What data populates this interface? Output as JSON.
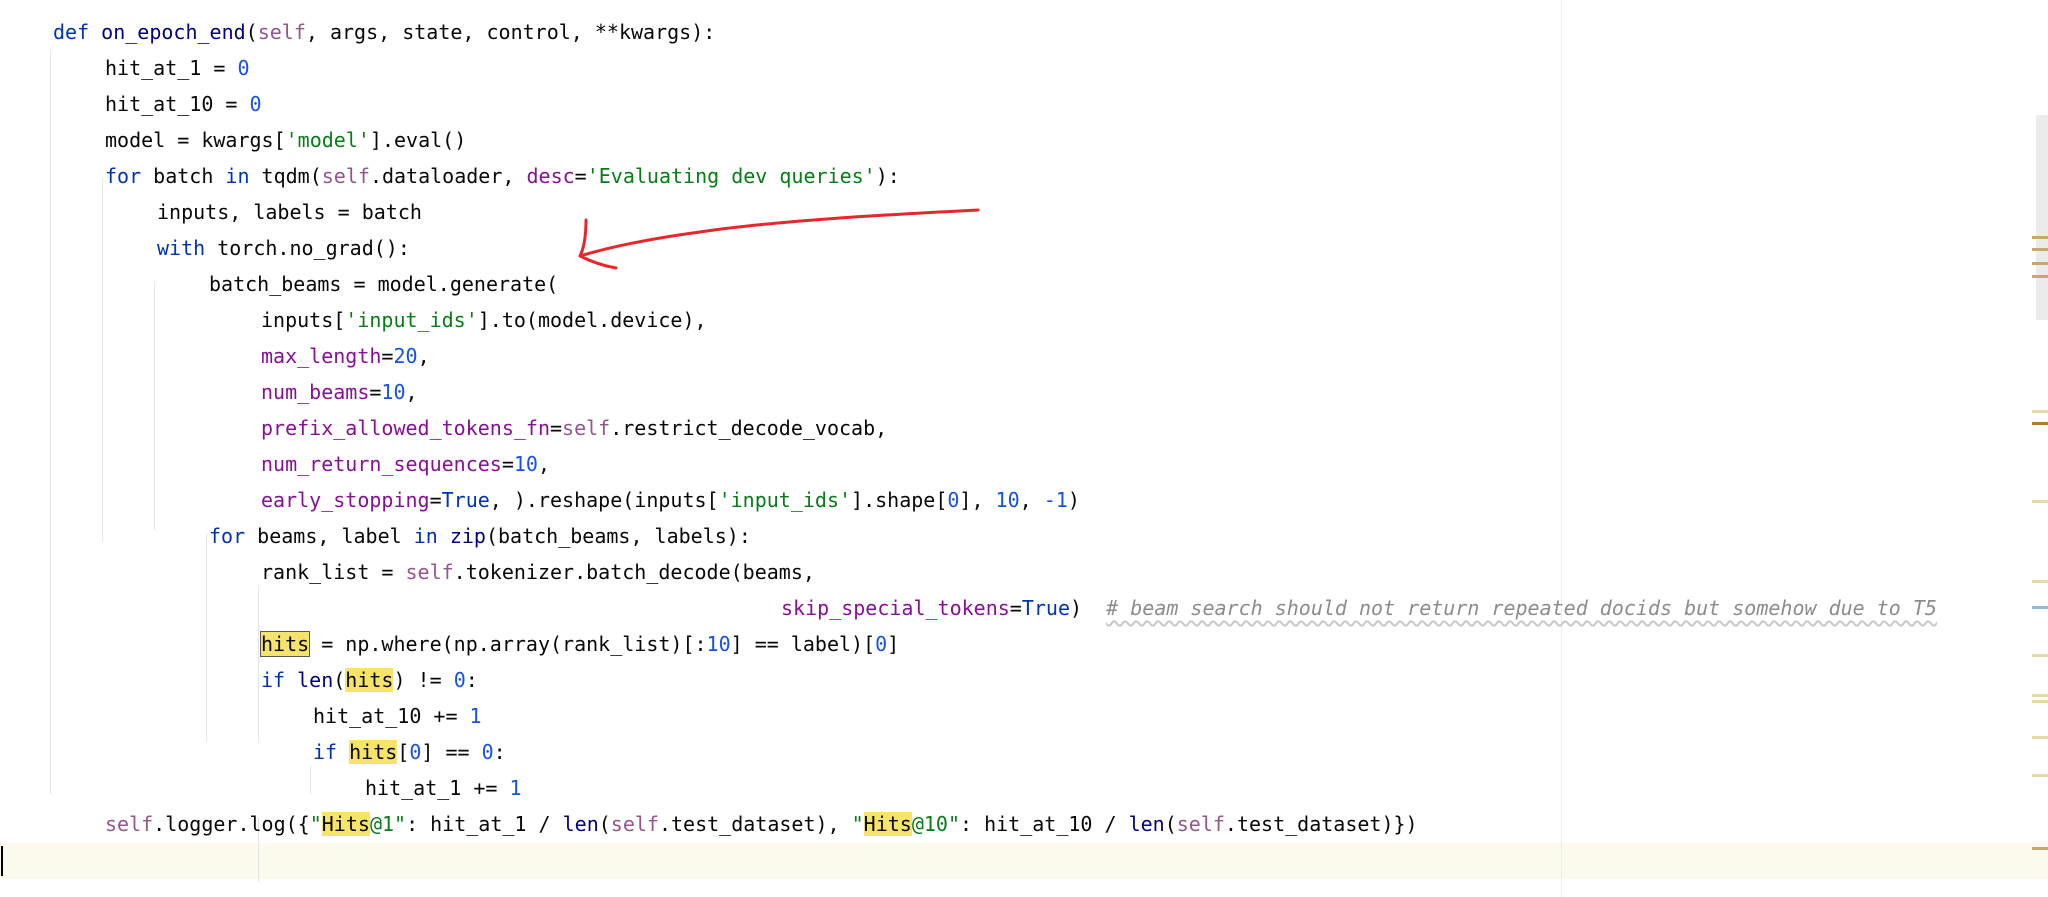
{
  "editor": {
    "lines": [
      {
        "segments": [
          [
            "kw",
            "def "
          ],
          [
            "builtin",
            "on_epoch_end"
          ],
          [
            "plain",
            "("
          ],
          [
            "self",
            "self"
          ],
          [
            "plain",
            ", args, state, control, **kwargs):"
          ]
        ]
      },
      {
        "segments": [
          [
            "plain",
            "hit_at_1 = "
          ],
          [
            "num",
            "0"
          ]
        ]
      },
      {
        "segments": [
          [
            "plain",
            "hit_at_10 = "
          ],
          [
            "num",
            "0"
          ]
        ]
      },
      {
        "segments": [
          [
            "plain",
            "model = kwargs["
          ],
          [
            "str",
            "'model'"
          ],
          [
            "plain",
            "].eval()"
          ]
        ]
      },
      {
        "segments": [
          [
            "kw",
            "for "
          ],
          [
            "plain",
            "batch "
          ],
          [
            "kw",
            "in "
          ],
          [
            "plain",
            "tqdm("
          ],
          [
            "self",
            "self"
          ],
          [
            "plain",
            ".dataloader, "
          ],
          [
            "param",
            "desc"
          ],
          [
            "plain",
            "="
          ],
          [
            "str",
            "'Evaluating dev queries'"
          ],
          [
            "plain",
            "):"
          ]
        ]
      },
      {
        "segments": [
          [
            "plain",
            "inputs, labels = batch"
          ]
        ]
      },
      {
        "segments": [
          [
            "kw",
            "with "
          ],
          [
            "plain",
            "torch.no_grad():"
          ]
        ]
      },
      {
        "segments": [
          [
            "plain",
            "batch_beams = model.generate("
          ]
        ]
      },
      {
        "segments": [
          [
            "plain",
            "inputs["
          ],
          [
            "str",
            "'input_ids'"
          ],
          [
            "plain",
            "].to(model.device),"
          ]
        ]
      },
      {
        "segments": [
          [
            "param",
            "max_length"
          ],
          [
            "plain",
            "="
          ],
          [
            "num",
            "20"
          ],
          [
            "plain",
            ","
          ]
        ]
      },
      {
        "segments": [
          [
            "param",
            "num_beams"
          ],
          [
            "plain",
            "="
          ],
          [
            "num",
            "10"
          ],
          [
            "plain",
            ","
          ]
        ]
      },
      {
        "segments": [
          [
            "param",
            "prefix_allowed_tokens_fn"
          ],
          [
            "plain",
            "="
          ],
          [
            "self",
            "self"
          ],
          [
            "plain",
            ".restrict_decode_vocab,"
          ]
        ]
      },
      {
        "segments": [
          [
            "param",
            "num_return_sequences"
          ],
          [
            "plain",
            "="
          ],
          [
            "num",
            "10"
          ],
          [
            "plain",
            ","
          ]
        ]
      },
      {
        "segments": [
          [
            "param",
            "early_stopping"
          ],
          [
            "plain",
            "="
          ],
          [
            "kw",
            "True"
          ],
          [
            "plain",
            ", ).reshape(inputs["
          ],
          [
            "str",
            "'input_ids'"
          ],
          [
            "plain",
            "].shape["
          ],
          [
            "num",
            "0"
          ],
          [
            "plain",
            "], "
          ],
          [
            "num",
            "10"
          ],
          [
            "plain",
            ", "
          ],
          [
            "num",
            "-1"
          ],
          [
            "plain",
            ")"
          ]
        ]
      },
      {
        "segments": [
          [
            "kw",
            "for "
          ],
          [
            "plain",
            "beams, label "
          ],
          [
            "kw",
            "in "
          ],
          [
            "builtin",
            "zip"
          ],
          [
            "plain",
            "(batch_beams, labels):"
          ]
        ]
      },
      {
        "segments": [
          [
            "plain",
            "rank_list = "
          ],
          [
            "self",
            "self"
          ],
          [
            "plain",
            ".tokenizer.batch_decode(beams,"
          ]
        ]
      },
      {
        "segments": [
          [
            "param",
            "skip_special_tokens"
          ],
          [
            "plain",
            "="
          ],
          [
            "kw",
            "True"
          ],
          [
            "plain",
            ")  "
          ],
          [
            "cmt",
            "# beam search should not return repeated docids but somehow due to T5"
          ]
        ]
      },
      {
        "segments": [
          [
            "hlbox",
            "hits"
          ],
          [
            "plain",
            " = np.where(np.array(rank_list)[:"
          ],
          [
            "num",
            "10"
          ],
          [
            "plain",
            "] == label)["
          ],
          [
            "num",
            "0"
          ],
          [
            "plain",
            "]"
          ]
        ]
      },
      {
        "segments": [
          [
            "kw",
            "if "
          ],
          [
            "builtin",
            "len"
          ],
          [
            "plain",
            "("
          ],
          [
            "hl",
            "hits"
          ],
          [
            "plain",
            ") != "
          ],
          [
            "num",
            "0"
          ],
          [
            "plain",
            ":"
          ]
        ]
      },
      {
        "segments": [
          [
            "plain",
            "hit_at_10 += "
          ],
          [
            "num",
            "1"
          ]
        ]
      },
      {
        "segments": [
          [
            "kw",
            "if "
          ],
          [
            "hl",
            "hits"
          ],
          [
            "plain",
            "["
          ],
          [
            "num",
            "0"
          ],
          [
            "plain",
            "] == "
          ],
          [
            "num",
            "0"
          ],
          [
            "plain",
            ":"
          ]
        ]
      },
      {
        "segments": [
          [
            "plain",
            "hit_at_1 += "
          ],
          [
            "num",
            "1"
          ]
        ]
      },
      {
        "segments": [
          [
            "self",
            "self"
          ],
          [
            "plain",
            ".logger.log({"
          ],
          [
            "str",
            "\""
          ],
          [
            "hl",
            "Hits"
          ],
          [
            "str",
            "@1\""
          ],
          [
            "plain",
            ": hit_at_1 / "
          ],
          [
            "builtin",
            "len"
          ],
          [
            "plain",
            "("
          ],
          [
            "self",
            "self"
          ],
          [
            "plain",
            ".test_dataset), "
          ],
          [
            "str",
            "\""
          ],
          [
            "hl",
            "Hits"
          ],
          [
            "str",
            "@10\""
          ],
          [
            "plain",
            ": hit_at_10 / "
          ],
          [
            "builtin",
            "len"
          ],
          [
            "plain",
            "("
          ],
          [
            "self",
            "self"
          ],
          [
            "plain",
            ".test_dataset)})"
          ]
        ]
      },
      {
        "segments": []
      }
    ]
  },
  "colors": {
    "keyword": "#0033b3",
    "self": "#94558d",
    "number": "#1750eb",
    "string": "#067d17",
    "param": "#871094",
    "comment": "#8c8c8c",
    "highlight": "#f6e46a",
    "annotation": "#e8262c"
  }
}
